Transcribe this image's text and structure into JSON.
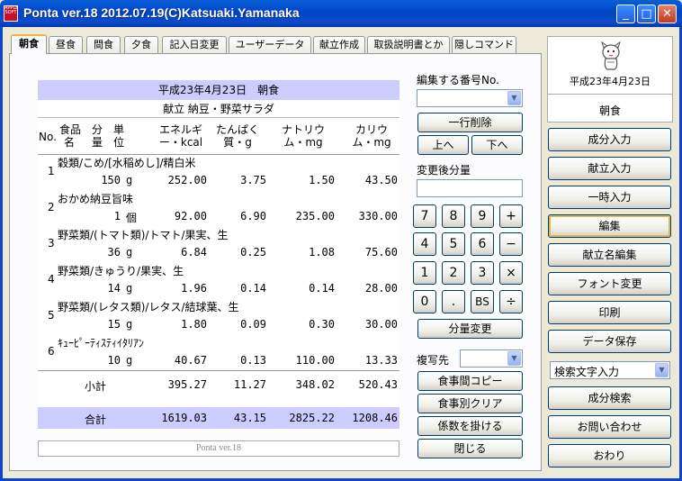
{
  "window": {
    "title": "Ponta ver.18 2012.07.19(C)Katsuaki.Yamanaka",
    "logo_text": "APPLE SOFT",
    "minimize": "_",
    "maximize": "□",
    "close": "✕"
  },
  "tabs": [
    "朝食",
    "昼食",
    "間食",
    "夕食",
    "記入日変更",
    "ユーザーデータ",
    "献立作成",
    "取扱説明書とか",
    "隠しコマンド"
  ],
  "sheet": {
    "date_title": "平成23年4月23日　朝食",
    "menu_name": "献立 納豆・野菜サラダ",
    "headers": {
      "no": "No.",
      "food": "食品\n名",
      "portion": "分\n量",
      "unit": "単\n位",
      "energy": "エネルギ\nー・kcal",
      "protein": "たんぱく\n質・g",
      "sodium": "ナトリウ\nム・mg",
      "potassium": "カリウ\nム・mg"
    },
    "rows": [
      {
        "no": "1",
        "name": "穀類/こめ/[水稲めし]/精白米",
        "amount": "150",
        "unit": "g",
        "energy": "252.00",
        "protein": "3.75",
        "sodium": "1.50",
        "potassium": "43.50"
      },
      {
        "no": "2",
        "name": "おかめ納豆旨味",
        "amount": "1",
        "unit": "個",
        "energy": "92.00",
        "protein": "6.90",
        "sodium": "235.00",
        "potassium": "330.00"
      },
      {
        "no": "3",
        "name": "野菜類/(トマト類)/トマト/果実、生",
        "amount": "36",
        "unit": "g",
        "energy": "6.84",
        "protein": "0.25",
        "sodium": "1.08",
        "potassium": "75.60"
      },
      {
        "no": "4",
        "name": "野菜類/きゅうり/果実、生",
        "amount": "14",
        "unit": "g",
        "energy": "1.96",
        "protein": "0.14",
        "sodium": "0.14",
        "potassium": "28.00"
      },
      {
        "no": "5",
        "name": "野菜類/(レタス類)/レタス/結球葉、生",
        "amount": "15",
        "unit": "g",
        "energy": "1.80",
        "protein": "0.09",
        "sodium": "0.30",
        "potassium": "30.00"
      },
      {
        "no": "6",
        "name": "ｷｭｰﾋﾟｰﾃｨｽﾃｨｲﾀﾘｱﾝ",
        "amount": "10",
        "unit": "g",
        "energy": "40.67",
        "protein": "0.13",
        "sodium": "110.00",
        "potassium": "13.33"
      }
    ],
    "subtotal": {
      "label": "小計",
      "energy": "395.27",
      "protein": "11.27",
      "sodium": "348.02",
      "potassium": "520.43"
    },
    "total": {
      "label": "合計",
      "energy": "1619.03",
      "protein": "43.15",
      "sodium": "2825.22",
      "potassium": "1208.46"
    },
    "footer": "Ponta ver.18"
  },
  "edit_panel": {
    "number_label": "編集する番号No.",
    "delete_row": "一行削除",
    "up": "上へ",
    "down": "下へ",
    "new_amount_label": "変更後分量",
    "keypad": [
      "7",
      "8",
      "9",
      "+",
      "4",
      "5",
      "6",
      "−",
      "1",
      "2",
      "3",
      "×",
      "0",
      ".",
      "BS",
      "÷"
    ],
    "change_amount": "分量変更",
    "copy_to_label": "複写先",
    "copy_between_meals": "食事間コピー",
    "clear_by_meal": "食事別クリア",
    "multiply": "係数を掛ける",
    "close": "閉じる"
  },
  "right_panel": {
    "date": "平成23年4月23日",
    "meal": "朝食",
    "buttons": [
      "成分入力",
      "献立入力",
      "一時入力",
      "編集",
      "献立名編集",
      "フォント変更",
      "印刷",
      "データ保存"
    ],
    "search_select": "検索文字入力",
    "buttons_bottom": [
      "成分検索",
      "お問い合わせ",
      "おわり"
    ]
  }
}
